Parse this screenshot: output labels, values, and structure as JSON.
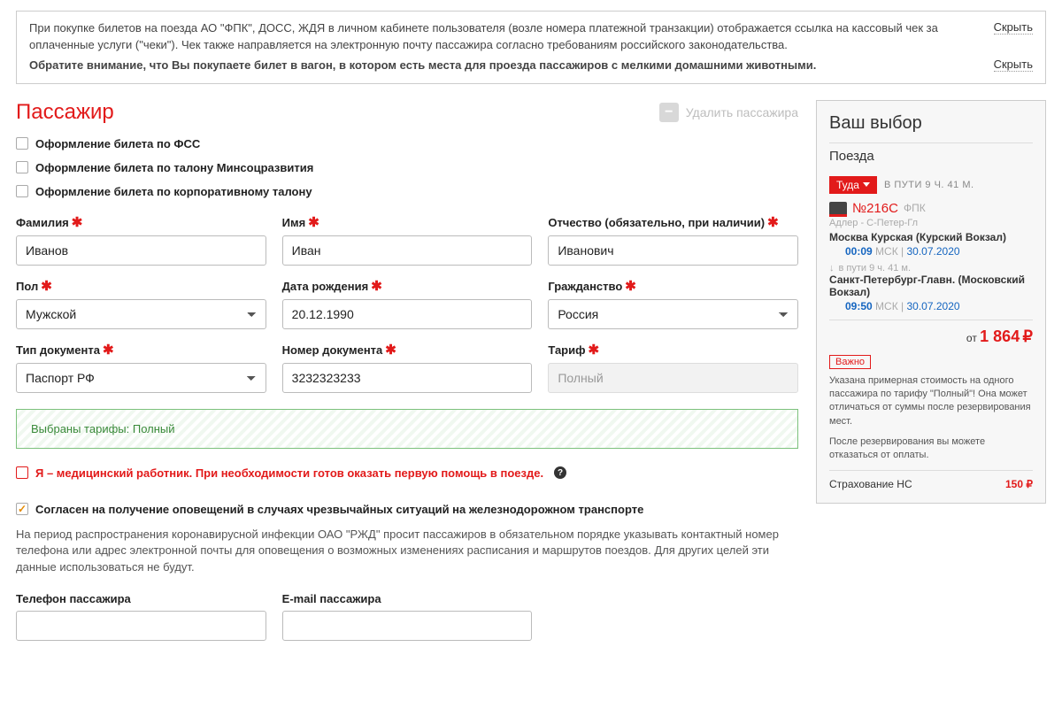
{
  "notices": {
    "n1": "При покупке билетов на поезда АО \"ФПК\", ДОСС, ЖДЯ в личном кабинете пользователя (возле номера платежной транзакции) отображается ссылка на кассовый чек за оплаченные услуги (\"чеки\"). Чек также направляется на электронную почту пассажира согласно требованиям российского законодательства.",
    "n2": "Обратите внимание, что Вы покупаете билет в вагон, в котором есть места для проезда пассажиров с мелкими домашними животными.",
    "hide": "Скрыть"
  },
  "passenger": {
    "title": "Пассажир",
    "delete": "Удалить пассажира",
    "opts": {
      "fss": "Оформление билета по ФСС",
      "minsoc": "Оформление билета по талону Минсоцразвития",
      "corp": "Оформление билета по корпоративному талону"
    },
    "labels": {
      "lastname": "Фамилия",
      "firstname": "Имя",
      "patronymic": "Отчество (обязательно, при наличии)",
      "gender": "Пол",
      "dob": "Дата рождения",
      "citizenship": "Гражданство",
      "doctype": "Тип документа",
      "docnum": "Номер документа",
      "tariff": "Тариф",
      "phone": "Телефон пассажира",
      "email": "E-mail пассажира"
    },
    "values": {
      "lastname": "Иванов",
      "firstname": "Иван",
      "patronymic": "Иванович",
      "gender": "Мужской",
      "dob": "20.12.1990",
      "citizenship": "Россия",
      "doctype": "Паспорт РФ",
      "docnum": "3232323233",
      "tariff": "Полный"
    },
    "tariff_strip": "Выбраны тарифы: Полный",
    "medic": "Я – медицинский работник. При необходимости готов оказать первую помощь в поезде.",
    "consent": "Согласен на получение оповещений в случаях чрезвычайных ситуаций на железнодорожном транспорте",
    "covid": "На период распространения коронавирусной инфекции ОАО \"РЖД\" просит пассажиров в обязательном порядке указывать контактный номер телефона или адрес электронной почты для оповещения о возможных изменениях расписания и маршрутов поездов. Для других целей эти данные использоваться не будут."
  },
  "sidebar": {
    "title": "Ваш выбор",
    "sub": "Поезда",
    "dir": "Туда",
    "dur_upper": "В ПУТИ 9 Ч. 41 М.",
    "train_num": "№216С",
    "train_co": "ФПК",
    "route": "Адлер - С-Петер-Гл",
    "st_from": "Москва Курская (Курский Вокзал)",
    "dep_time": "00:09",
    "tz": "МСК",
    "dep_date": "30.07.2020",
    "mid_dur": "в пути  9 ч. 41 м.",
    "st_to": "Санкт-Петербург-Главн. (Московский Вокзал)",
    "arr_time": "09:50",
    "arr_date": "30.07.2020",
    "price_pre": "от ",
    "price": "1 864",
    "currency": "₽",
    "imp_label": "Важно",
    "imp1": "Указана примерная стоимость на одного пассажира по тарифу \"Полный\"! Она может отличаться от суммы после резервирования мест.",
    "imp2": "После резервирования вы можете отказаться от оплаты.",
    "ins_label": "Страхование НС",
    "ins_price": "150 ₽"
  }
}
